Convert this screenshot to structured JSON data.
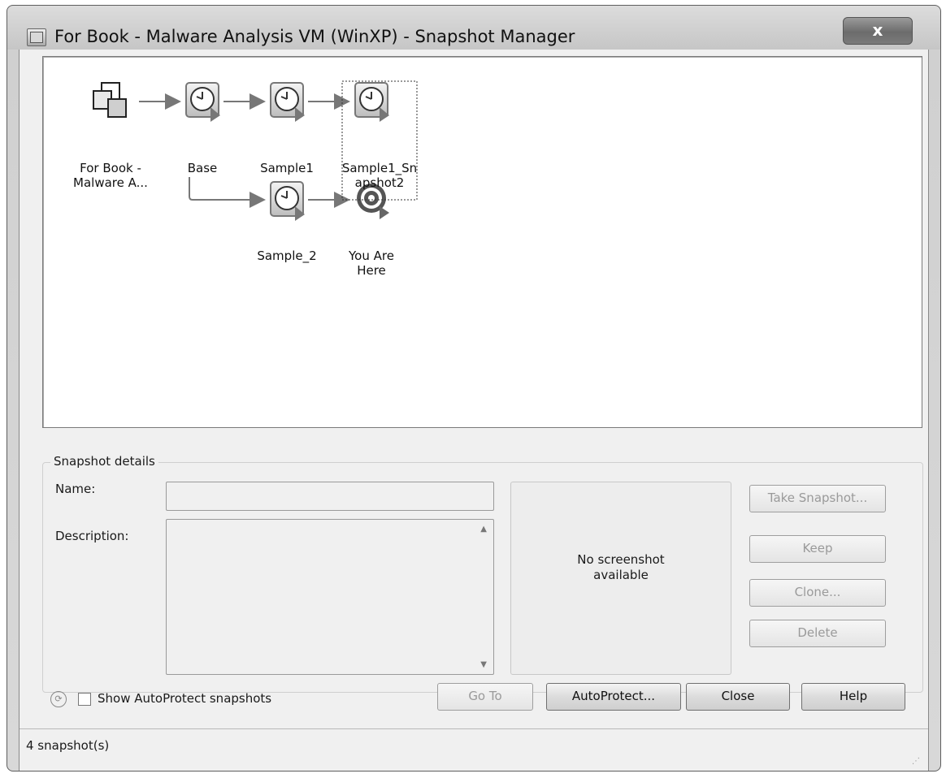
{
  "window": {
    "title": "For Book - Malware Analysis VM (WinXP) - Snapshot Manager",
    "close_label": "x"
  },
  "tree": {
    "nodes": [
      {
        "label": "For Book -\nMalware A...",
        "icon": "vm-icon"
      },
      {
        "label": "Base",
        "icon": "snapshot-clock-icon"
      },
      {
        "label": "Sample1",
        "icon": "snapshot-clock-icon"
      },
      {
        "label": "Sample1_Sn\napshot2",
        "icon": "snapshot-clock-icon",
        "selected": true
      },
      {
        "label": "Sample_2",
        "icon": "snapshot-clock-icon"
      },
      {
        "label": "You Are\nHere",
        "icon": "you-are-here-target-icon"
      }
    ]
  },
  "details": {
    "group_label": "Snapshot details",
    "name_label": "Name:",
    "name_value": "",
    "description_label": "Description:",
    "description_value": "",
    "preview_text": "No screenshot\navailable"
  },
  "buttons": {
    "take_snapshot": "Take Snapshot...",
    "keep": "Keep",
    "clone": "Clone...",
    "delete": "Delete",
    "go_to": "Go To",
    "autoprotect": "AutoProtect...",
    "close": "Close",
    "help": "Help"
  },
  "options": {
    "show_autoprotect_label": "Show AutoProtect snapshots",
    "show_autoprotect_checked": false
  },
  "status": {
    "text": "4 snapshot(s)"
  }
}
